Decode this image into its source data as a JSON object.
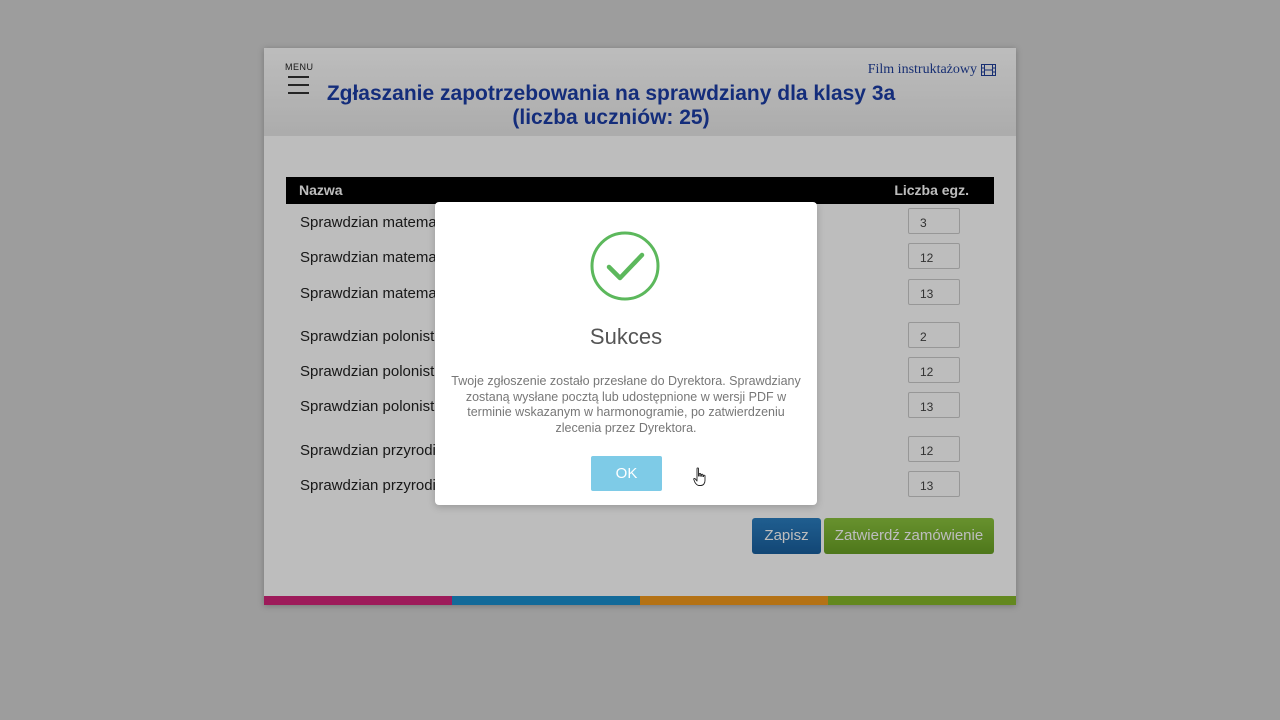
{
  "header": {
    "menu_label": "MENU",
    "film_link": "Film instruktażowy",
    "title_line1": "Zgłaszanie zapotrzebowania na sprawdziany dla klasy 3a",
    "title_line2": "(liczba uczniów: 25)"
  },
  "table": {
    "col_name": "Nazwa",
    "col_qty": "Liczba egz.",
    "rows": [
      {
        "name": "Sprawdzian matema",
        "qty": "3"
      },
      {
        "name": "Sprawdzian matema",
        "qty": "12"
      },
      {
        "name": "Sprawdzian matema",
        "qty": "13"
      },
      {
        "name": "Sprawdzian polonist",
        "qty": "2"
      },
      {
        "name": "Sprawdzian polonist",
        "qty": "12"
      },
      {
        "name": "Sprawdzian polonist",
        "qty": "13"
      },
      {
        "name": "Sprawdzian przyrodi",
        "qty": "12"
      },
      {
        "name": "Sprawdzian przyrodi",
        "qty": "13"
      }
    ]
  },
  "buttons": {
    "save": "Zapisz",
    "confirm": "Zatwierdź zamówienie"
  },
  "modal": {
    "title": "Sukces",
    "message": "Twoje zgłoszenie zostało przesłane do Dyrektora. Sprawdziany zostaną wysłane pocztą lub udostępnione w wersji PDF w terminie wskazanym w harmonogramie, po zatwierdzeniu zlecenia przez Dyrektora.",
    "ok": "OK"
  },
  "colors": {
    "title": "#1c3da6",
    "success_green": "#5cb85c",
    "ok_button": "#7ecbe7",
    "save_button": "#1f6dae",
    "confirm_button": "#7bb433",
    "stripe": [
      "#d4257a",
      "#1a8fcf",
      "#f39a1d",
      "#86b82b"
    ]
  },
  "icons": [
    "hamburger-menu-icon",
    "film-icon",
    "success-check-icon",
    "hand-cursor-icon"
  ]
}
